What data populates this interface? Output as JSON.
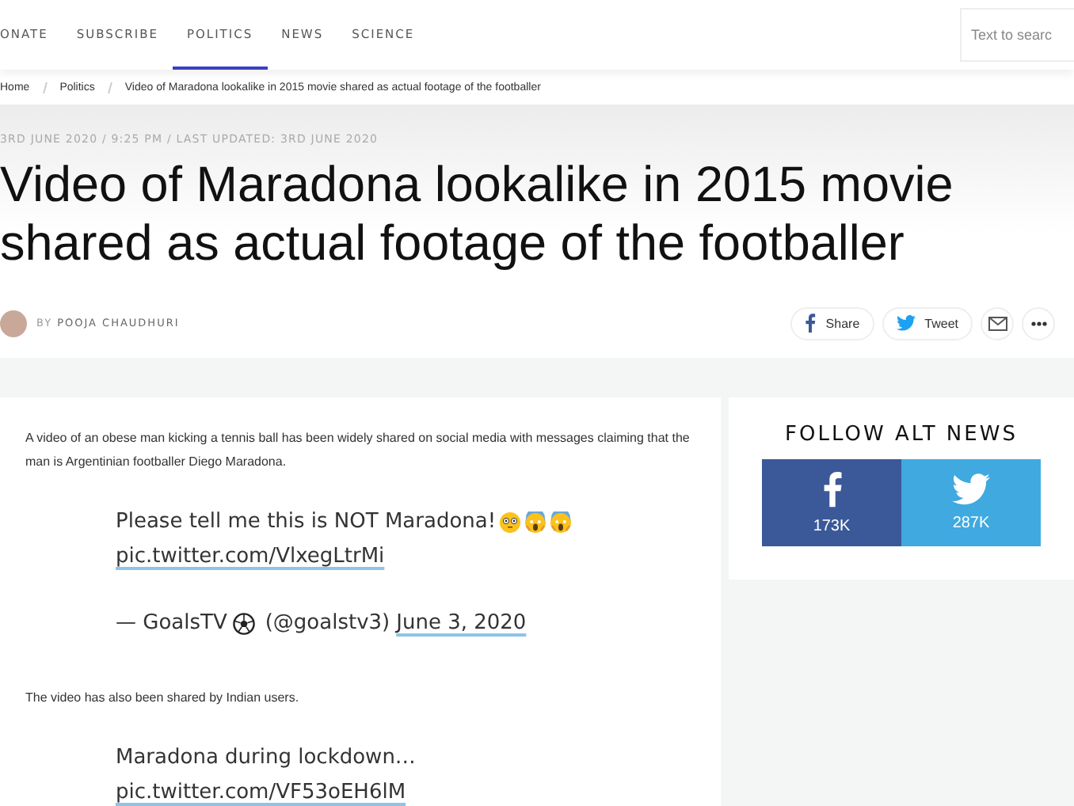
{
  "nav": {
    "items": [
      {
        "label": "ONATE",
        "selected": false
      },
      {
        "label": "SUBSCRIBE",
        "selected": false
      },
      {
        "label": "POLITICS",
        "selected": true
      },
      {
        "label": "NEWS",
        "selected": false
      },
      {
        "label": "SCIENCE",
        "selected": false
      }
    ],
    "search": {
      "placeholder": "Text to searc"
    }
  },
  "breadcrumb": [
    "Home",
    "Politics",
    "Video of Maradona lookalike in 2015 movie shared as actual footage of the footballer"
  ],
  "article": {
    "dateline": "3RD JUNE 2020 / 9:25 PM / LAST UPDATED: 3RD JUNE 2020",
    "title": "Video of Maradona lookalike in 2015 movie shared as actual footage of the footballer",
    "byline": {
      "by": "BY",
      "author": "POOJA CHAUDHURI"
    },
    "share": [
      {
        "kind": "facebook",
        "label": "Share"
      },
      {
        "kind": "twitter",
        "label": "Tweet"
      },
      {
        "kind": "mail"
      },
      {
        "kind": "more"
      }
    ],
    "body": [
      {
        "kind": "paragraph",
        "text": "A video of an obese man kicking a tennis ball has been widely shared on social media with messages claiming that the man is Argentinian footballer Diego Maradona."
      },
      {
        "kind": "tweet",
        "text": "Please tell me this is NOT Maradona!",
        "emoji": true,
        "link": "pic.twitter.com/VlxegLtrMi",
        "author": "— GoalsTV",
        "author_ball": true,
        "handle": "(@goalstv3)",
        "date": "June 3, 2020"
      },
      {
        "kind": "paragraph",
        "text": "The video has also been shared by Indian users."
      },
      {
        "kind": "tweet",
        "text": "Maradona during lockdown…",
        "emoji": false,
        "link": "pic.twitter.com/VF53oEH6lM"
      }
    ]
  },
  "sidebar": {
    "title": "FOLLOW ALT NEWS",
    "follow": [
      {
        "kind": "facebook",
        "count": "173K"
      },
      {
        "kind": "twitter",
        "count": "287K"
      }
    ]
  }
}
